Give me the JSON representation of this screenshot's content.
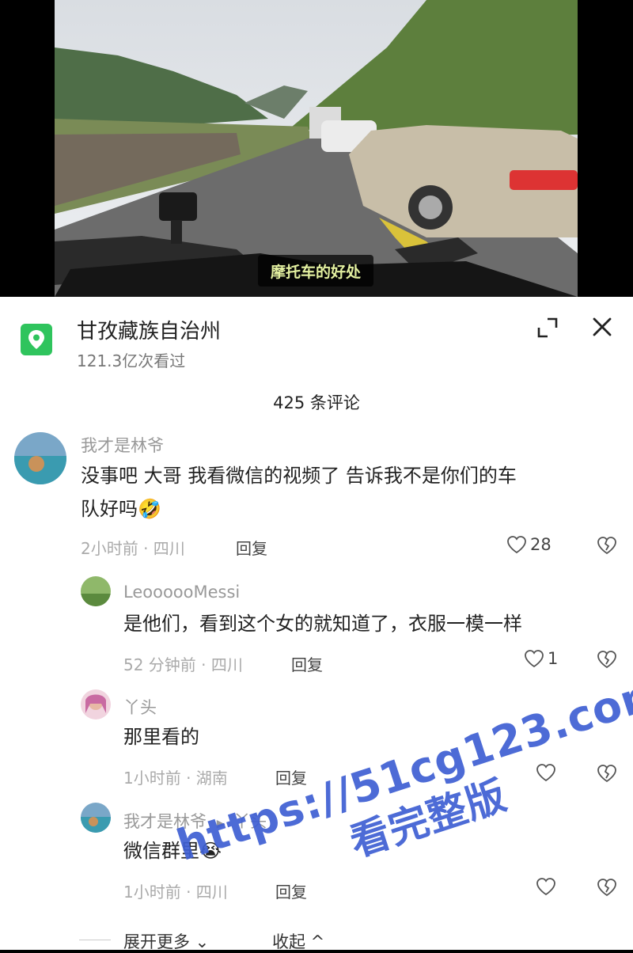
{
  "video": {
    "caption": "摩托车的好处"
  },
  "location": {
    "title": "甘孜藏族自治州",
    "views": "121.3亿次看过",
    "icon": "location-pin-icon"
  },
  "comment_count": "425 条评论",
  "comments": [
    {
      "user": "我才是林爷",
      "text1": "没事吧 大哥 我看微信的视频了 告诉我不是你们的车",
      "text2": "队好吗",
      "emoji": "🤣",
      "meta": "2小时前 · 四川",
      "reply": "回复",
      "likes": "28"
    },
    {
      "user": "LeoooooMessi",
      "text": "是他们，看到这个女的就知道了，衣服一模一样",
      "meta": "52 分钟前 · 四川",
      "reply": "回复",
      "likes": "1"
    },
    {
      "user": "丫头",
      "text": "那里看的",
      "meta": "1小时前 · 湖南",
      "reply": "回复"
    },
    {
      "user": "我才是林爷",
      "arrow": "▶",
      "reply_to": "丫头",
      "text": "微信群里",
      "emoji": "😭",
      "meta": "1小时前 · 四川",
      "reply": "回复"
    }
  ],
  "footer": {
    "expand": "展开更多",
    "collapse": "收起"
  },
  "watermark": {
    "line1": "https://51cg123.com",
    "line2": "看完整版"
  }
}
